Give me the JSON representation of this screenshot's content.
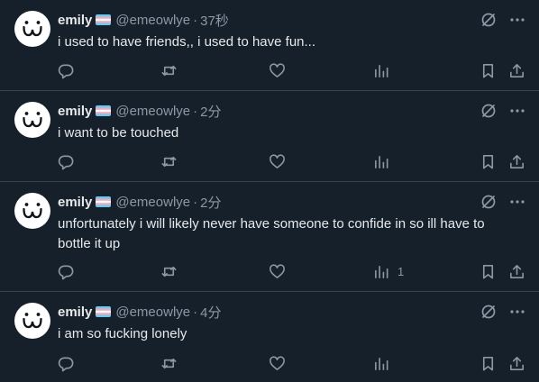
{
  "colors": {
    "background": "#15202b",
    "divider": "#38444d",
    "text_primary": "#e7e9ea",
    "text_secondary": "#8b98a5"
  },
  "icons": {
    "avatar": "kaomoji-face",
    "flag": "transgender-flag",
    "grok": "slashed-circle-icon",
    "more": "more-dots-icon",
    "reply": "reply-bubble-icon",
    "retweet": "retweet-icon",
    "like": "heart-icon",
    "views": "bar-chart-icon",
    "bookmark": "bookmark-icon",
    "share": "share-icon"
  },
  "tweets": [
    {
      "name": "emily",
      "handle": "@emeowlye",
      "separator": "·",
      "time": "37秒",
      "text": "i used to have friends,, i used to have fun...",
      "views_count": ""
    },
    {
      "name": "emily",
      "handle": "@emeowlye",
      "separator": "·",
      "time": "2分",
      "text": "i want to be touched",
      "views_count": ""
    },
    {
      "name": "emily",
      "handle": "@emeowlye",
      "separator": "·",
      "time": "2分",
      "text": "unfortunately i will likely never have someone to confide in so ill have to bottle it up",
      "views_count": "1"
    },
    {
      "name": "emily",
      "handle": "@emeowlye",
      "separator": "·",
      "time": "4分",
      "text": "i am so fucking lonely",
      "views_count": ""
    }
  ]
}
